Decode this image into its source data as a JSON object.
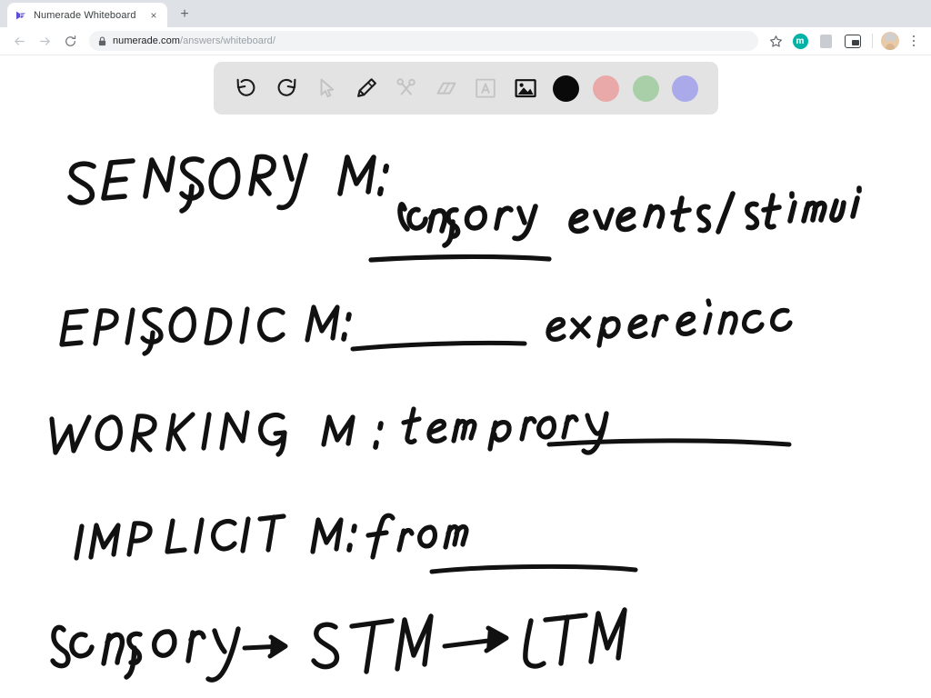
{
  "browser": {
    "tab": {
      "title": "Numerade Whiteboard",
      "favicon_name": "numerade-logo-icon",
      "favicon_color": "#5a4fd6",
      "close_label": "×"
    },
    "new_tab_label": "+",
    "nav": {
      "back_label": "←",
      "forward_label": "→",
      "reload_label": "↻"
    },
    "omnibox": {
      "url_host": "numerade.com",
      "url_path": "/answers/whiteboard/",
      "lock_icon_name": "lock-icon"
    },
    "actions": {
      "bookmark_label": "☆",
      "extension_1_letter": "m",
      "extension_1_color": "#00b3a4",
      "extension_2_name": "extension-icon",
      "pip_name": "picture-in-picture-icon",
      "avatar_name": "profile-avatar",
      "menu_name": "chrome-menu-icon"
    }
  },
  "whiteboard": {
    "toolbar": {
      "tools": [
        {
          "name": "undo-icon",
          "label": "Undo",
          "state": "enabled"
        },
        {
          "name": "redo-icon",
          "label": "Redo",
          "state": "enabled"
        },
        {
          "name": "cursor-icon",
          "label": "Select",
          "state": "disabled"
        },
        {
          "name": "pencil-icon",
          "label": "Pen",
          "state": "active"
        },
        {
          "name": "scissors-icon",
          "label": "Cut",
          "state": "disabled"
        },
        {
          "name": "eraser-icon",
          "label": "Eraser",
          "state": "disabled"
        },
        {
          "name": "text-icon",
          "label": "Text",
          "state": "disabled"
        },
        {
          "name": "image-icon",
          "label": "Image",
          "state": "active"
        }
      ],
      "colors": [
        {
          "name": "color-swatch-black",
          "label": "Black",
          "hex": "#0a0a0a",
          "selected": true
        },
        {
          "name": "color-swatch-pink",
          "label": "Pink",
          "hex": "#eaa9a9",
          "selected": false
        },
        {
          "name": "color-swatch-green",
          "label": "Green",
          "hex": "#a9cfa9",
          "selected": false
        },
        {
          "name": "color-swatch-purple",
          "label": "Purple",
          "hex": "#aaaaea",
          "selected": false
        }
      ]
    },
    "ink_color": "#111111",
    "notes": [
      {
        "id": "line-sensory",
        "text": "SENSORY M: sensory events/stimuli",
        "term": "SENSORY M:",
        "answer": "sensory",
        "answer_underlined": true,
        "rest": "events/stimuli"
      },
      {
        "id": "line-episodic",
        "text": "EPISODIC M: ______ experience",
        "term": "EPISODIC M:",
        "answer": "",
        "answer_underlined": true,
        "rest": "experience"
      },
      {
        "id": "line-working",
        "text": "WORKING M : temporary ________",
        "term": "WORKING M :",
        "answer": "temporary",
        "answer_underlined": false,
        "rest": ""
      },
      {
        "id": "line-implicit",
        "text": "IMPLICIT M : from ______",
        "term": "IMPLICIT M :",
        "answer": "from",
        "answer_underlined": false,
        "rest": ""
      },
      {
        "id": "line-flow",
        "text": "sensory → STM → LTM",
        "term": "sensory",
        "answer": "STM",
        "answer_underlined": false,
        "rest": "LTM"
      }
    ]
  }
}
